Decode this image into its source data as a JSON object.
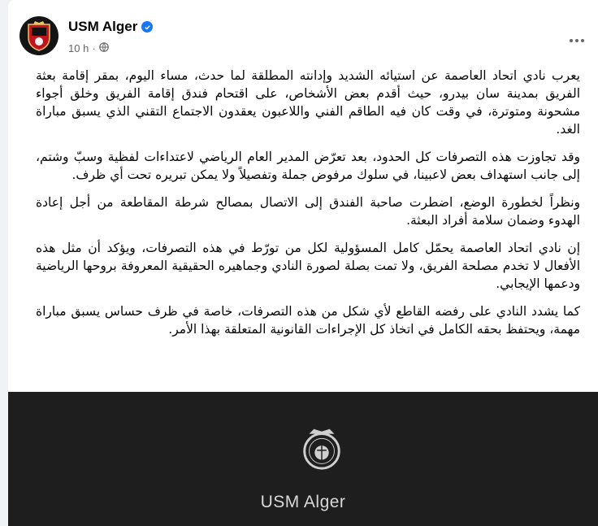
{
  "post": {
    "page_name": "USM Alger",
    "timestamp": "10 h",
    "separator": "·",
    "paragraphs": [
      "يعرب نادي اتحاد العاصمة عن استيائه الشديد وإدانته المطلقة لما حدث، مساء اليوم، بمقر إقامة بعثة الفريق بمدينة سان بيدرو، حيث أقدم بعض الأشخاص، على اقتحام فندق إقامة الفريق وخلق أجواء مشحونة ومتوترة، في وقت كان فيه الطاقم الفني واللاعبون يعقدون الاجتماع التقني الذي يسبق مباراة الغد.",
      "وقد تجاوزت هذه التصرفات كل الحدود، بعد تعرّض المدير العام الرياضي لاعتداءات لفظية وسبّ وشتم، إلى جانب استهداف بعض لاعبينا، في سلوك مرفوض جملة وتفصيلاً ولا يمكن تبريره تحت أي ظرف.",
      "ونظراً لخطورة الوضع، اضطرت صاحبة الفندق إلى الاتصال بمصالح شرطة المقاطعة من أجل إعادة الهدوء وضمان سلامة أفراد البعثة.",
      "إن نادي اتحاد العاصمة يحمّل كامل المسؤولية لكل من تورّط في هذه التصرفات، ويؤكد أن مثل هذه الأفعال لا تخدم مصلحة الفريق، ولا تمت بصلة لصورة النادي وجماهيره الحقيقية المعروفة بروحها الرياضية ودعمها الإيجابي.",
      "كما يشدد النادي على رفضه القاطع لأي شكل من هذه التصرفات، خاصة في ظرف حساس يسبق مباراة مهمة، ويحتفظ بحقه الكامل في اتخاذ كل الإجراءات القانونية المتعلقة بهذا الأمر."
    ]
  },
  "media": {
    "caption": "USM Alger"
  },
  "icons": {
    "verified": "verified-badge-icon",
    "audience": "globe-icon",
    "more": "more-options-icon"
  },
  "colors": {
    "verified": "#1877f2",
    "meta": "#65676b",
    "media_bg": "#1e1e1e"
  }
}
